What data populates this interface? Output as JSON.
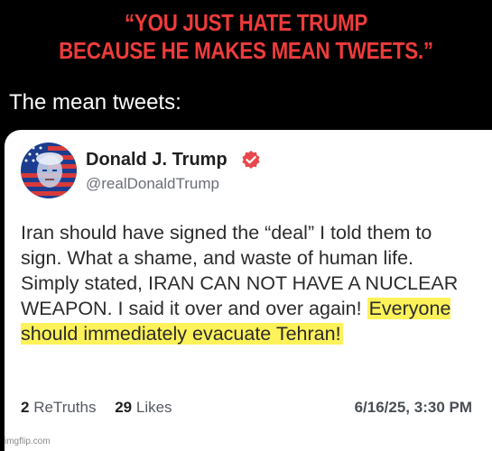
{
  "meme": {
    "quote_line1": "“YOU JUST HATE TRUMP",
    "quote_line2": "BECAUSE HE MAKES MEAN TWEETS.”",
    "caption": "The mean tweets:"
  },
  "post": {
    "author_name": "Donald J. Trump",
    "author_handle": "@realDonaldTrump",
    "verified_icon": "verified-check-icon",
    "body_text_1": "Iran should have signed the “deal” I told them to sign. What a shame, and waste of human life. Simply stated, IRAN CAN NOT HAVE A NUCLEAR WEAPON. I said it over and over again! ",
    "body_highlight": "Everyone should immediately evacuate Tehran!",
    "retruths_count": "2",
    "retruths_label": "ReTruths",
    "likes_count": "29",
    "likes_label": "Likes",
    "timestamp": "6/16/25, 3:30 PM"
  },
  "watermark": "imgflip.com",
  "colors": {
    "quote": "#ef3b3b",
    "caption": "#ffffff",
    "highlight": "#fdf25a",
    "verified": "#e8484b"
  }
}
